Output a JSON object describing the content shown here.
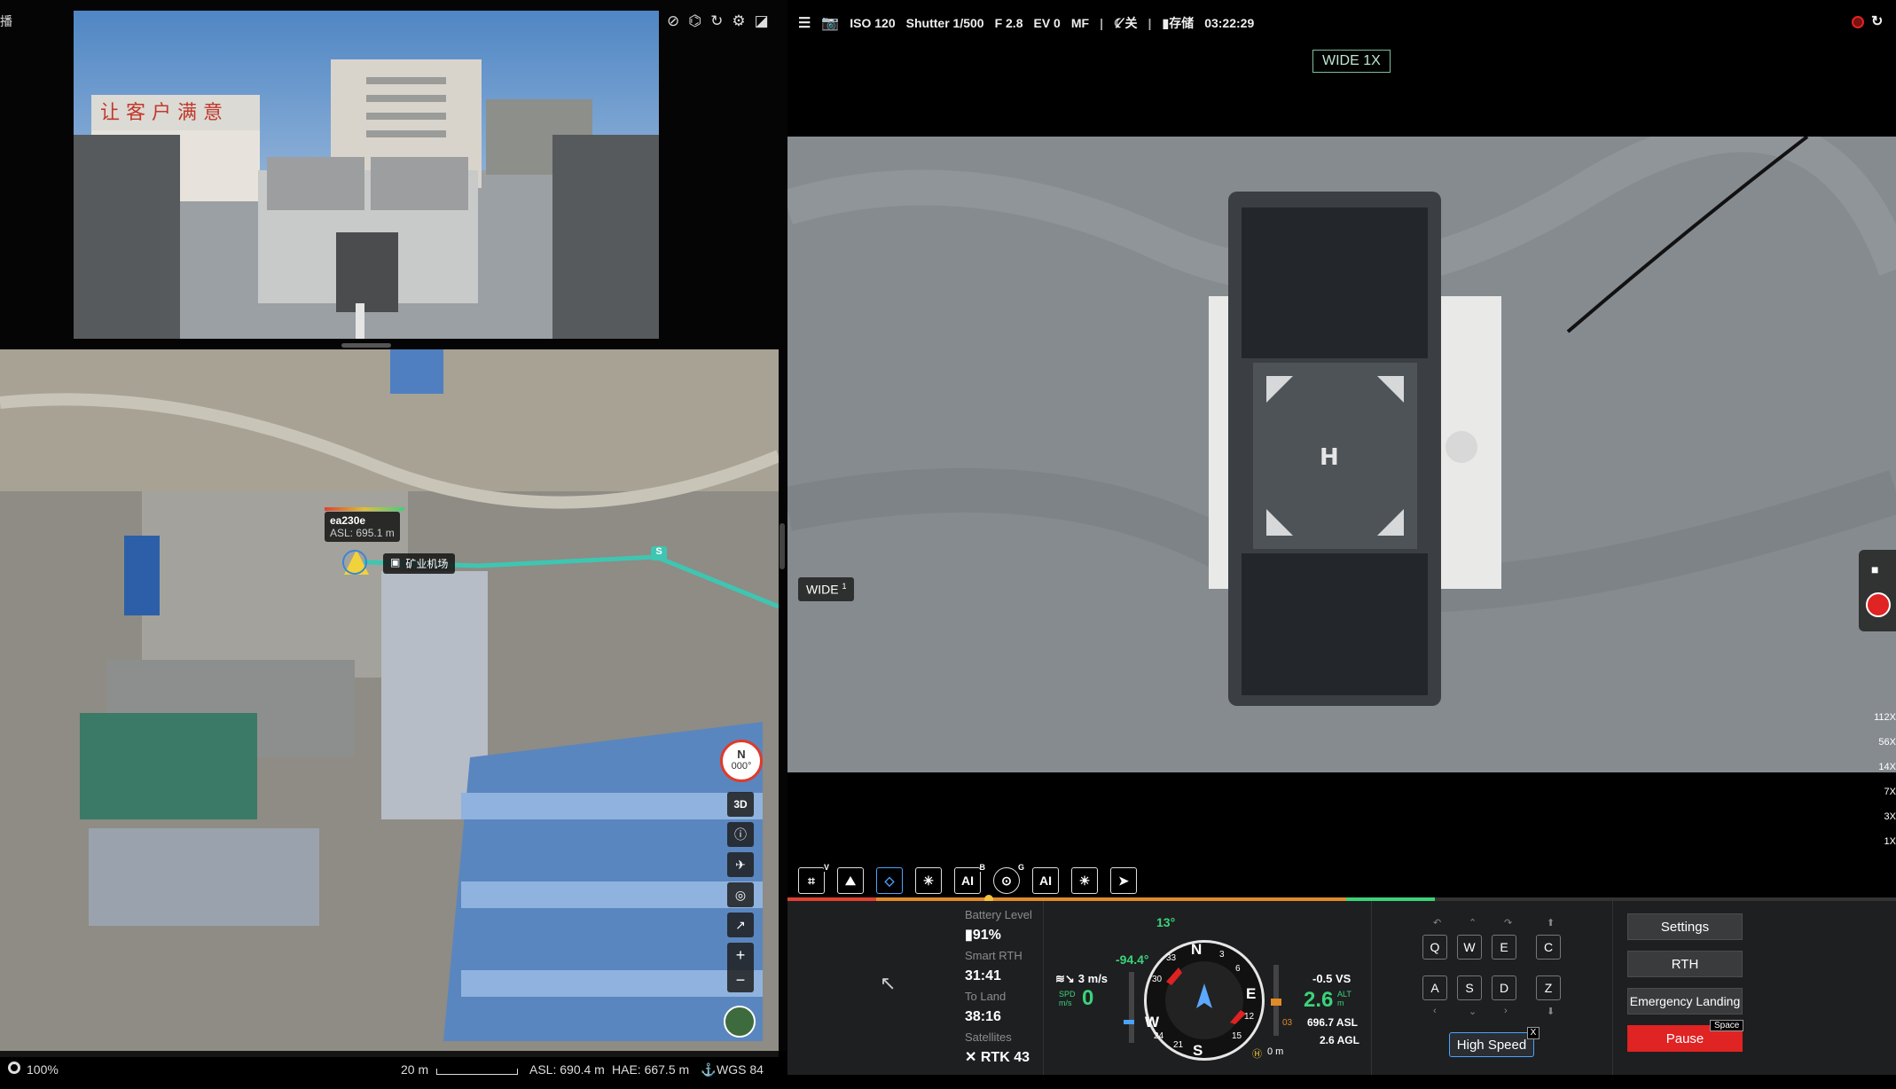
{
  "dock": {
    "title_fragment": "播",
    "icons": [
      "pin-off-icon",
      "satellite-icon",
      "refresh-icon",
      "gear-icon",
      "expand-icon"
    ]
  },
  "map": {
    "drone_name": "ea230e",
    "drone_asl": "ASL: 695.1 m",
    "dock_label": "矿业机场",
    "waypoint_label": "S",
    "compass_letter": "N",
    "compass_heading": "000°",
    "button_3d": "3D",
    "zoom_percent": "100%",
    "scale": "20 m",
    "asl": "ASL: 690.4 m",
    "hae": "HAE: 667.5 m",
    "datum": "WGS 84"
  },
  "camera_bar": {
    "iso": "ISO 120",
    "shutter": "Shutter 1/500",
    "aperture": "F 2.8",
    "ev": "EV 0",
    "focus": "MF",
    "night": "关",
    "storage": "存储",
    "time": "03:22:29"
  },
  "camera": {
    "lens": "WIDE 1X",
    "wide_tag": "WIDE",
    "wide_tag_index": "1",
    "zoom_levels": [
      "112X",
      "56X",
      "14X",
      "7X",
      "3X",
      "1X"
    ]
  },
  "toolbar": {
    "v_badge": "V",
    "ai_label": "AI",
    "ai_badge": "B",
    "g_badge": "G",
    "ai2_label": "AI"
  },
  "telemetry": {
    "battery_label": "Battery Level",
    "battery_value": "91%",
    "rth_label": "Smart RTH",
    "rth_value": "31:41",
    "land_label": "To Land",
    "land_value": "38:16",
    "sat_label": "Satellites",
    "sat_value": "RTK 43",
    "heading_top": "13°",
    "pitch": "-94.4°",
    "wind": "3 m/s",
    "spd_unit_top": "SPD",
    "spd_unit_bottom": "m/s",
    "spd_value": "0",
    "vs": "-0.5 VS",
    "alt_value": "2.6",
    "alt_unit_top": "ALT",
    "alt_unit_bottom": "m",
    "asl": "696.7 ASL",
    "agl": "2.6 AGL",
    "home_dist": "0 m",
    "gauge_value": "03",
    "compass_marks": {
      "n": "N",
      "e": "E",
      "s": "S",
      "w": "W",
      "m3": "3",
      "m6": "6",
      "m12": "12",
      "m15": "15",
      "m21": "21",
      "m24": "24",
      "m30": "30",
      "m33": "33"
    }
  },
  "keys": {
    "row1": [
      "Q",
      "W",
      "E",
      "C"
    ],
    "row2": [
      "A",
      "S",
      "D",
      "Z"
    ],
    "high_speed": "High Speed",
    "close": "X"
  },
  "actions": {
    "settings": "Settings",
    "rth": "RTH",
    "emergency": "Emergency Landing",
    "pause": "Pause",
    "pause_key": "Space"
  },
  "colors": {
    "pause_red": "#e02323",
    "accent_green": "#3bd37a",
    "route_teal": "#3ec6b2",
    "warn_orange": "#e08a28"
  }
}
